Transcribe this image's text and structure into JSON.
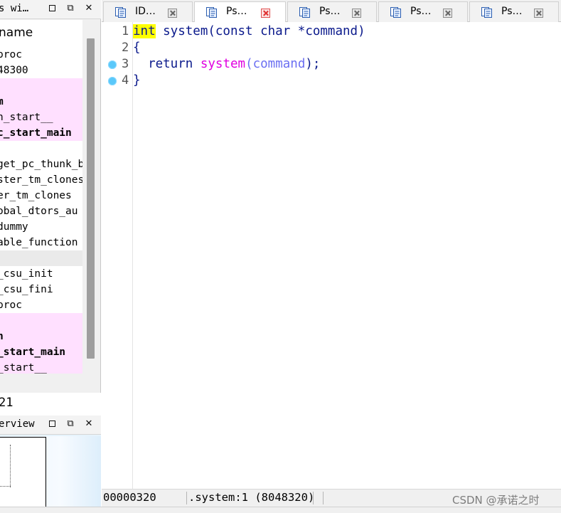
{
  "functions_window": {
    "title": "s wi…",
    "column_header": "name",
    "rows": [
      {
        "text": "proc",
        "style": ""
      },
      {
        "text": "48300",
        "style": ""
      },
      {
        "text": "",
        "style": "pink"
      },
      {
        "text": "m",
        "style": "pink bold"
      },
      {
        "text": "n_start__",
        "style": "pink"
      },
      {
        "text": "c_start_main",
        "style": "pink bold"
      },
      {
        "text": "",
        "style": ""
      },
      {
        "text": "get_pc_thunk_b",
        "style": ""
      },
      {
        "text": "ster_tm_clones",
        "style": ""
      },
      {
        "text": "er_tm_clones",
        "style": ""
      },
      {
        "text": "obal_dtors_au",
        "style": ""
      },
      {
        "text": "dummy",
        "style": ""
      },
      {
        "text": "able_function",
        "style": ""
      },
      {
        "text": "",
        "style": "gray"
      },
      {
        "text": "_csu_init",
        "style": ""
      },
      {
        "text": "_csu_fini",
        "style": ""
      },
      {
        "text": "proc",
        "style": ""
      },
      {
        "text": "",
        "style": "pink"
      },
      {
        "text": "n",
        "style": "pink bold"
      },
      {
        "text": "_start_main",
        "style": "pink bold"
      },
      {
        "text": "_start__",
        "style": "pink"
      }
    ],
    "count_text": "21"
  },
  "overview_window": {
    "title": "erview"
  },
  "tabs": [
    {
      "label": "ID…",
      "active": false,
      "close_style": "gray"
    },
    {
      "label": "Ps…",
      "active": true,
      "close_style": "red"
    },
    {
      "label": "Ps…",
      "active": false,
      "close_style": "gray"
    },
    {
      "label": "Ps…",
      "active": false,
      "close_style": "gray"
    },
    {
      "label": "Ps…",
      "active": false,
      "close_style": "gray"
    }
  ],
  "code": {
    "line_numbers": [
      "1",
      "2",
      "3",
      "4"
    ],
    "breakpoint_lines": [
      3,
      4
    ],
    "lines": {
      "l1_kw": "int",
      "l1_rest": " system(const char *command)",
      "l2": "{",
      "l3_indent": "  ",
      "l3_kw": "return",
      "l3_space": " ",
      "l3_fn": "system",
      "l3_paren": "(",
      "l3_param": "command",
      "l3_end": ");",
      "l4": "}"
    }
  },
  "status_bar": {
    "address": "00000320",
    "location": ".system:1 (8048320)"
  },
  "watermark": "CSDN @承诺之时",
  "colors": {
    "highlight": "#ffff00",
    "code_text": "#0b1a8c",
    "function_call": "#e000e0",
    "parameter": "#6b6ff2",
    "breakpoint": "#5ac8fa",
    "pink_row": "#ffe0ff"
  }
}
